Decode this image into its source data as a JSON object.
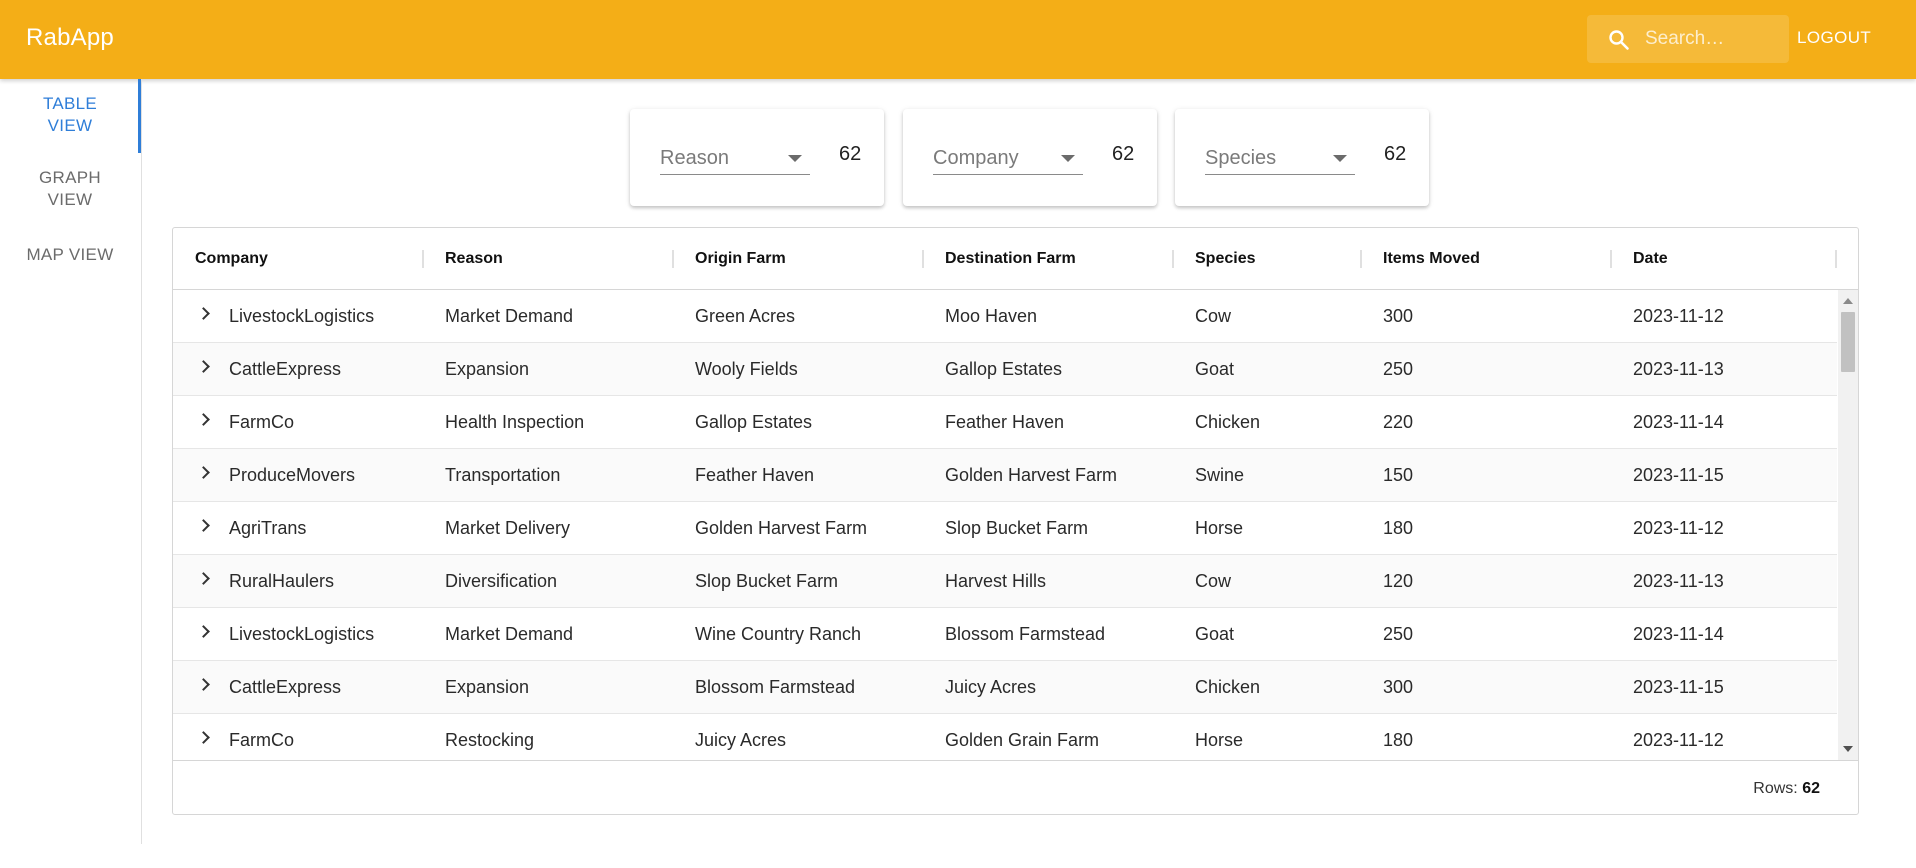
{
  "app": {
    "title": "RabApp"
  },
  "header": {
    "search_placeholder": "Search…",
    "logout_label": "LOGOUT"
  },
  "sidebar": {
    "items": [
      {
        "label_line1": "TABLE",
        "label_line2": "VIEW",
        "active": true
      },
      {
        "label_line1": "GRAPH",
        "label_line2": "VIEW",
        "active": false
      },
      {
        "label_line1": "MAP VIEW",
        "label_line2": "",
        "active": false
      }
    ]
  },
  "filters": [
    {
      "label": "Reason",
      "count": "62"
    },
    {
      "label": "Company",
      "count": "62"
    },
    {
      "label": "Species",
      "count": "62"
    }
  ],
  "table": {
    "columns": [
      "Company",
      "Reason",
      "Origin Farm",
      "Destination Farm",
      "Species",
      "Items Moved",
      "Date"
    ],
    "rows": [
      [
        "LivestockLogistics",
        "Market Demand",
        "Green Acres",
        "Moo Haven",
        "Cow",
        "300",
        "2023-11-12"
      ],
      [
        "CattleExpress",
        "Expansion",
        "Wooly Fields",
        "Gallop Estates",
        "Goat",
        "250",
        "2023-11-13"
      ],
      [
        "FarmCo",
        "Health Inspection",
        "Gallop Estates",
        "Feather Haven",
        "Chicken",
        "220",
        "2023-11-14"
      ],
      [
        "ProduceMovers",
        "Transportation",
        "Feather Haven",
        "Golden Harvest Farm",
        "Swine",
        "150",
        "2023-11-15"
      ],
      [
        "AgriTrans",
        "Market Delivery",
        "Golden Harvest Farm",
        "Slop Bucket Farm",
        "Horse",
        "180",
        "2023-11-12"
      ],
      [
        "RuralHaulers",
        "Diversification",
        "Slop Bucket Farm",
        "Harvest Hills",
        "Cow",
        "120",
        "2023-11-13"
      ],
      [
        "LivestockLogistics",
        "Market Demand",
        "Wine Country Ranch",
        "Blossom Farmstead",
        "Goat",
        "250",
        "2023-11-14"
      ],
      [
        "CattleExpress",
        "Expansion",
        "Blossom Farmstead",
        "Juicy Acres",
        "Chicken",
        "300",
        "2023-11-15"
      ],
      [
        "FarmCo",
        "Restocking",
        "Juicy Acres",
        "Golden Grain Farm",
        "Horse",
        "180",
        "2023-11-12"
      ]
    ],
    "footer_label": "Rows:",
    "row_count": "62"
  },
  "colors": {
    "appbar": "#f4ae17",
    "accent": "#2f7ed8",
    "header_text": "#ffffff"
  },
  "icons": {
    "search": "search-icon",
    "expand": "chevron-right-icon",
    "dropdown": "caret-down-icon"
  }
}
